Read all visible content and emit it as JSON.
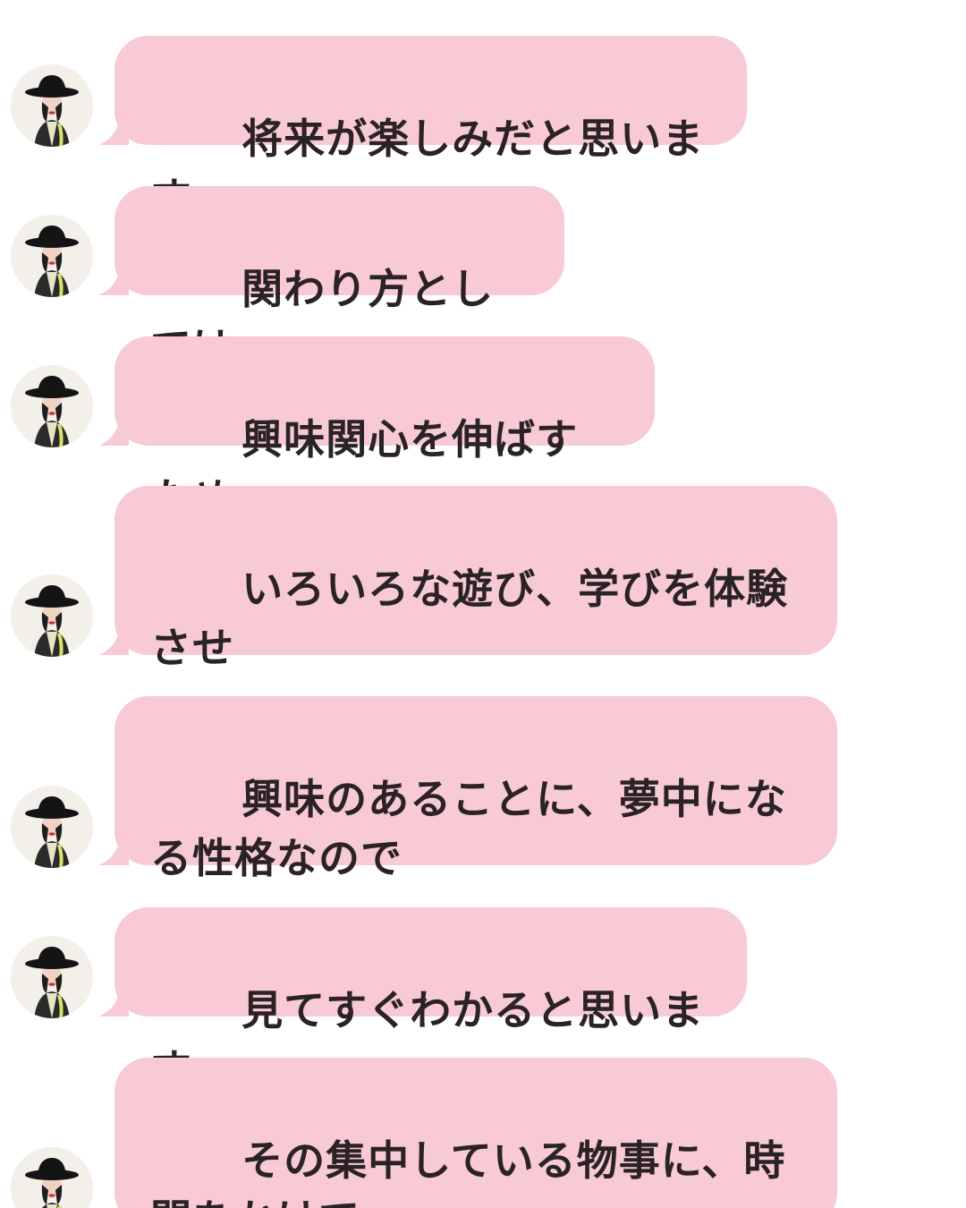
{
  "chat": {
    "bubble_color": "#f7cad5",
    "text_color": "#2a2224",
    "avatar_icon": "person-black-hat-avatar",
    "messages": [
      {
        "text": "将来が楽しみだと思います"
      },
      {
        "text": "関わり方としては"
      },
      {
        "text": "興味関心を伸ばすため"
      },
      {
        "text": "いろいろな遊び、学びを体験させ"
      },
      {
        "text": "興味のあることに、夢中になる性格なので"
      },
      {
        "text": "見てすぐわかると思います"
      },
      {
        "text": "その集中している物事に、時間をかけて"
      }
    ]
  }
}
